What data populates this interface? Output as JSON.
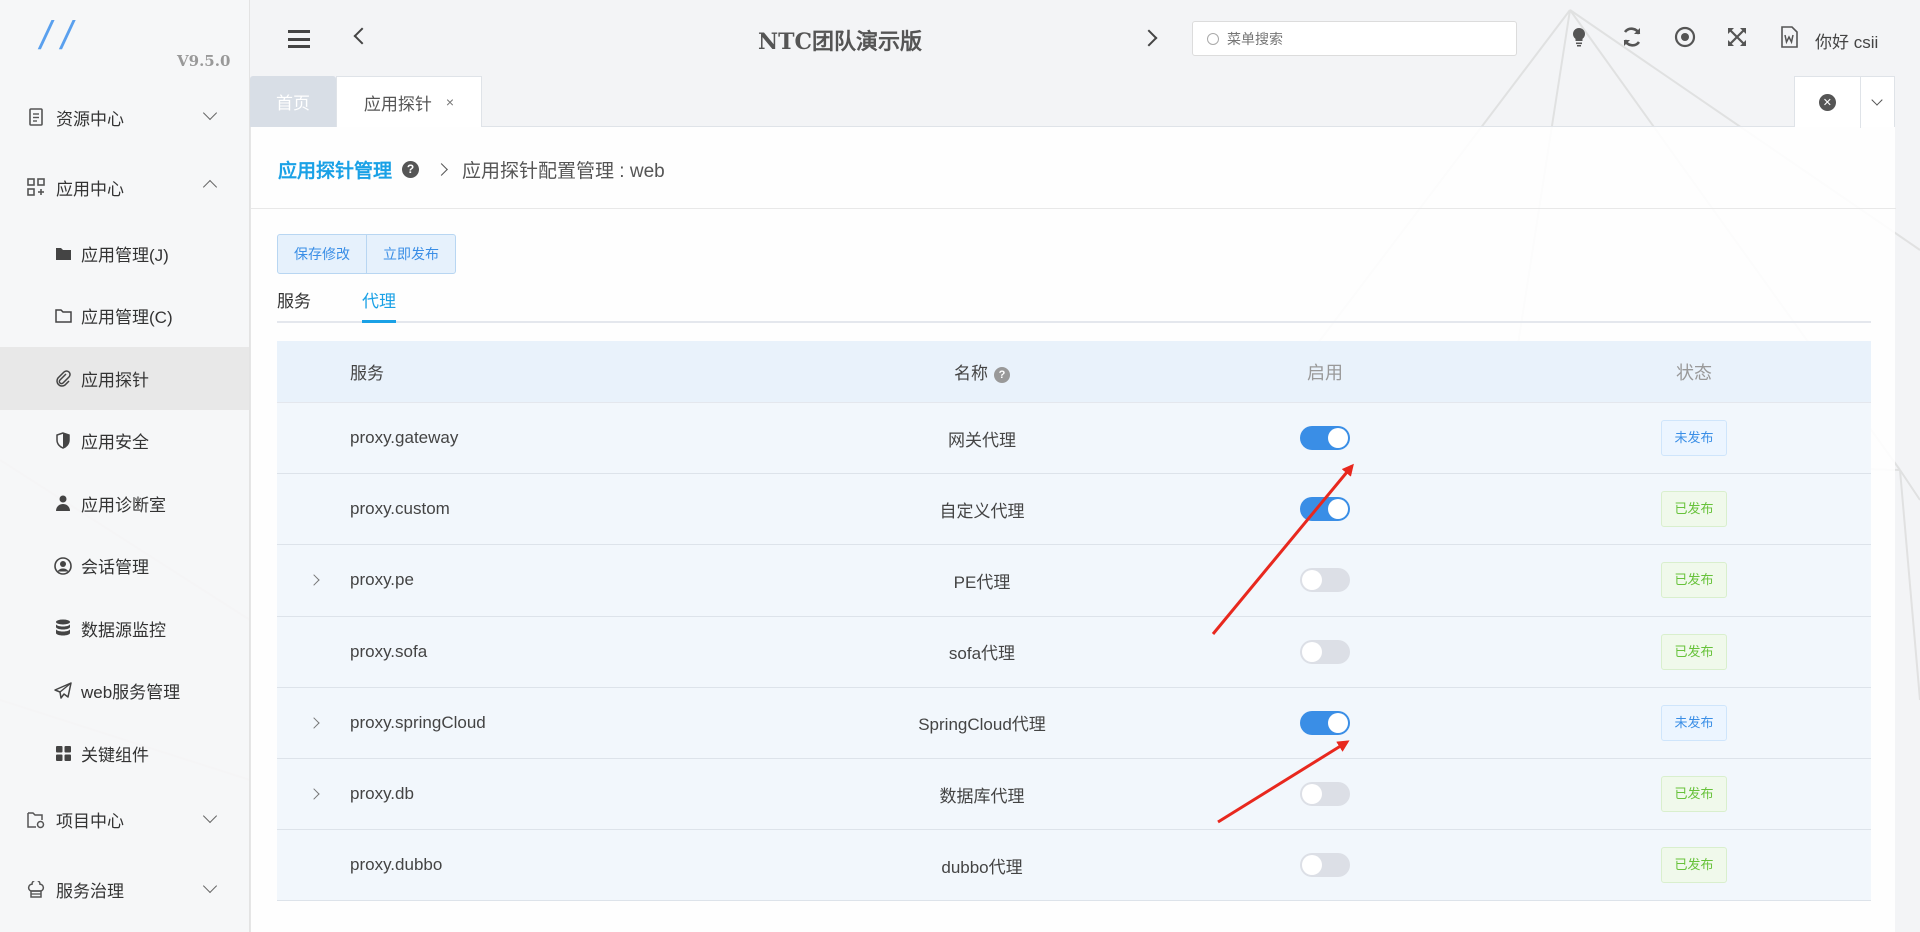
{
  "app": {
    "title": "NTC团队演示版",
    "version": "V9.5.0",
    "logo_text": "//"
  },
  "header": {
    "search_placeholder": "菜单搜索",
    "greeting": "你好 csii",
    "icons": [
      "bulb-icon",
      "refresh-icon",
      "target-icon",
      "fullscreen-icon",
      "word-doc-icon"
    ]
  },
  "sidebar": {
    "groups": [
      {
        "label": "资源中心",
        "icon": "document-icon",
        "expanded": false
      },
      {
        "label": "应用中心",
        "icon": "grid-icon",
        "expanded": true
      },
      {
        "label": "项目中心",
        "icon": "project-icon",
        "expanded": false
      },
      {
        "label": "服务治理",
        "icon": "chef-icon",
        "expanded": false
      }
    ],
    "items": [
      {
        "label": "应用管理(J)",
        "icon": "folder-filled-icon"
      },
      {
        "label": "应用管理(C)",
        "icon": "folder-outline-icon"
      },
      {
        "label": "应用探针",
        "icon": "paperclip-icon",
        "active": true
      },
      {
        "label": "应用安全",
        "icon": "shield-icon"
      },
      {
        "label": "应用诊断室",
        "icon": "doctor-icon"
      },
      {
        "label": "会话管理",
        "icon": "user-circle-icon"
      },
      {
        "label": "数据源监控",
        "icon": "database-icon"
      },
      {
        "label": "web服务管理",
        "icon": "paper-plane-icon"
      },
      {
        "label": "关键组件",
        "icon": "components-icon"
      }
    ]
  },
  "tabs": {
    "home": "首页",
    "current": "应用探针",
    "close_symbol": "×"
  },
  "breadcrumb": {
    "root": "应用探针管理",
    "help": "?",
    "leaf": "应用探针配置管理 : web"
  },
  "actions": {
    "save": "保存修改",
    "publish": "立即发布"
  },
  "subtabs": [
    {
      "label": "服务",
      "active": false
    },
    {
      "label": "代理",
      "active": true
    }
  ],
  "table": {
    "headers": {
      "service": "服务",
      "name": "名称",
      "name_help": "?",
      "enabled": "启用",
      "status": "状态"
    },
    "rows": [
      {
        "service": "proxy.gateway",
        "name": "网关代理",
        "expandable": false,
        "enabled": true,
        "status": "未发布"
      },
      {
        "service": "proxy.custom",
        "name": "自定义代理",
        "expandable": false,
        "enabled": true,
        "status": "已发布"
      },
      {
        "service": "proxy.pe",
        "name": "PE代理",
        "expandable": true,
        "enabled": false,
        "status": "已发布"
      },
      {
        "service": "proxy.sofa",
        "name": "sofa代理",
        "expandable": false,
        "enabled": false,
        "status": "已发布"
      },
      {
        "service": "proxy.springCloud",
        "name": "SpringCloud代理",
        "expandable": true,
        "enabled": true,
        "status": "未发布"
      },
      {
        "service": "proxy.db",
        "name": "数据库代理",
        "expandable": true,
        "enabled": false,
        "status": "已发布"
      },
      {
        "service": "proxy.dubbo",
        "name": "dubbo代理",
        "expandable": false,
        "enabled": false,
        "status": "已发布"
      }
    ]
  },
  "colors": {
    "accent": "#1aa1e6",
    "switch_on": "#3a8ee6",
    "published": "#67c23a",
    "annotation_arrow": "#e8281e"
  }
}
